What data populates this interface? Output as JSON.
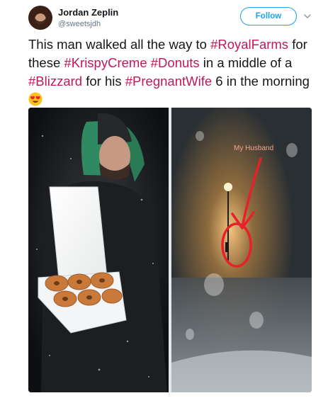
{
  "user": {
    "name": "Jordan Zeplin",
    "handle": "@sweetsjdh"
  },
  "header": {
    "follow_label": "Follow",
    "caret_icon": "chevron-down-icon"
  },
  "tweet": {
    "segments": [
      {
        "text": "This man walked all the way to ",
        "hashtag": false
      },
      {
        "text": "#RoyalFarms",
        "hashtag": true
      },
      {
        "text": " for these ",
        "hashtag": false
      },
      {
        "text": "#KrispyCreme",
        "hashtag": true
      },
      {
        "text": " ",
        "hashtag": false
      },
      {
        "text": "#Donuts",
        "hashtag": true
      },
      {
        "text": " in a middle of a ",
        "hashtag": false
      },
      {
        "text": "#Blizzard",
        "hashtag": true
      },
      {
        "text": " for his ",
        "hashtag": false
      },
      {
        "text": "#PregnantWife",
        "hashtag": true
      },
      {
        "text": " 6 in the morning",
        "hashtag": false
      }
    ],
    "emoji": "heart-eyes-emoji"
  },
  "media": {
    "photo_right_caption": "My Husband"
  },
  "colors": {
    "hashtag": "#c2185b",
    "follow": "#1da1f2",
    "annotation": "#e8202a"
  }
}
